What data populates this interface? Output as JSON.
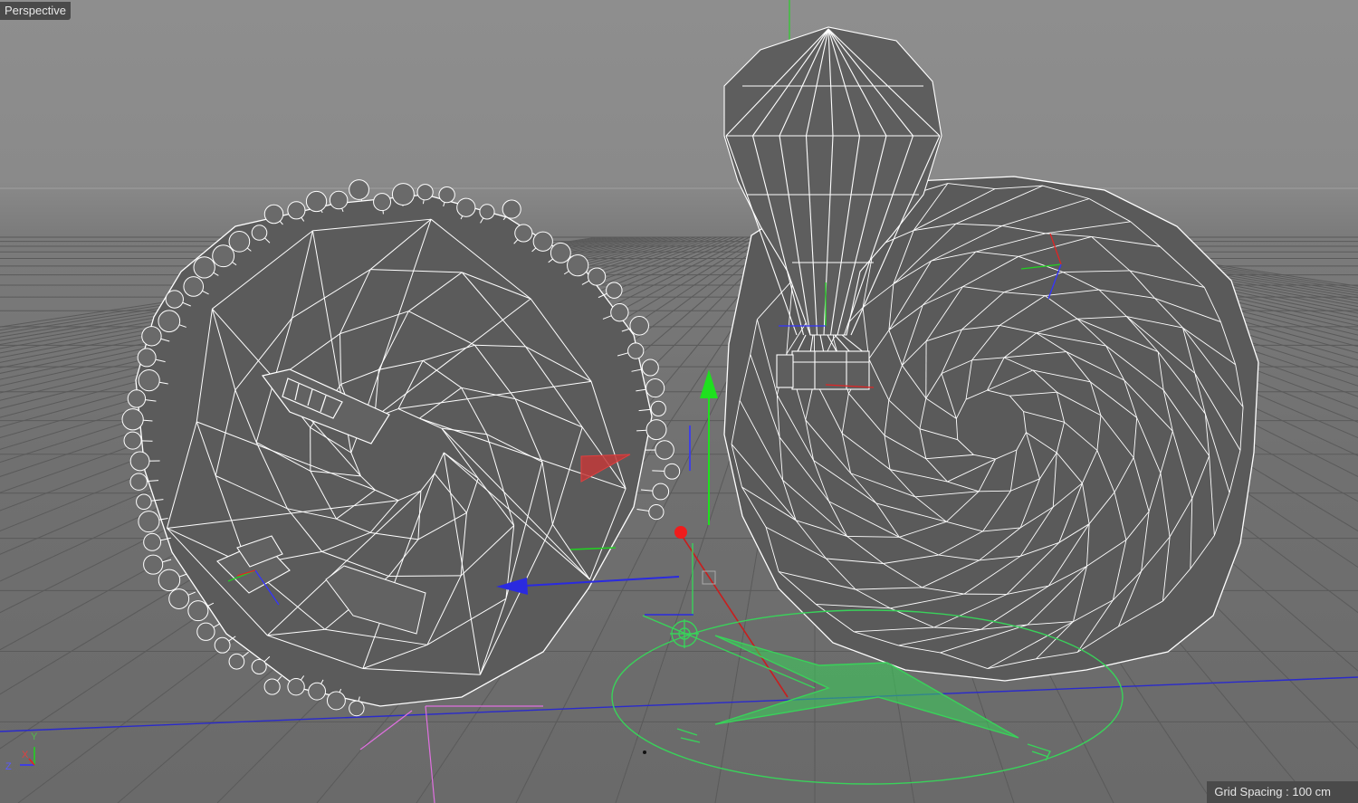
{
  "viewport": {
    "camera_label": "Perspective"
  },
  "status": {
    "grid_spacing_label": "Grid Spacing",
    "grid_spacing_value": "100 cm"
  },
  "axis_gizmo": {
    "y": "Y",
    "x": "X",
    "z": "Z"
  },
  "colors": {
    "background_top": "#8e8e8e",
    "floor": "#6a6a6a",
    "wireframe": "#ffffff",
    "mesh_fill": "#5f5f5f",
    "axis_x": "#e02020",
    "axis_y": "#20d020",
    "axis_z": "#2020e0",
    "light_gizmo": "#39d25a"
  },
  "icons": {
    "move_arrow_x": "arrow-icon",
    "move_arrow_y": "arrow-icon",
    "move_arrow_z": "arrow-icon"
  }
}
